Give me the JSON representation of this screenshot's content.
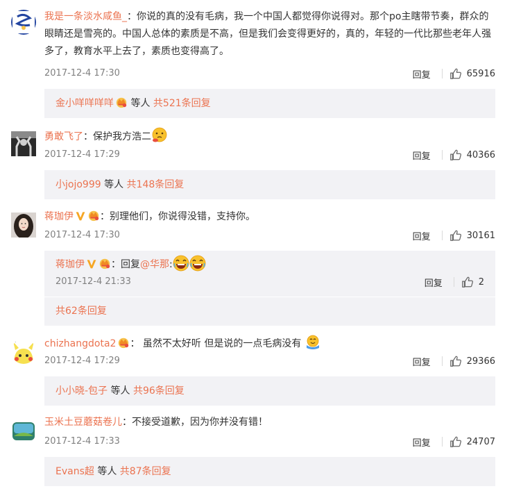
{
  "comments": [
    {
      "user": "我是一条淡水咸鱼_",
      "text": "：你说的真的没有毛病，我一个中国人都觉得你说得对。那个po主瞎带节奏，群众的眼睛还是雪亮的。中国人总体的素质是不高，但是我们会变得更好的，真的，年轻的一代比那些老年人强多了，教育水平上去了，素质也变得高了。",
      "time": "2017-12-4 17:30",
      "reply_label": "回复",
      "likes": "65916",
      "more_user": "金小咩咩咩咩",
      "more_mid": " 等人 ",
      "more_count": "共521条回复"
    },
    {
      "user": "勇敢飞了",
      "text": "：保护我方浩二",
      "time": "2017-12-4 17:29",
      "reply_label": "回复",
      "likes": "40366",
      "more_user": "小jojo999",
      "more_mid": " 等人 ",
      "more_count": "共148条回复"
    },
    {
      "user": "蒋珈伊",
      "text": "：别理他们，你说得没错，支持你。",
      "time": "2017-12-4 17:30",
      "reply_label": "回复",
      "likes": "30161",
      "sub_reply": {
        "user": "蒋珈伊",
        "text_a": "：回复",
        "mention": "@华那",
        "text_b": ":",
        "time": "2017-12-4 21:33",
        "reply_label": "回复",
        "likes": "2"
      },
      "more_count": "共62条回复"
    },
    {
      "user": "chizhangdota2",
      "text": "： 虽然不太好听 但是说的一点毛病没有",
      "time": "2017-12-4 17:29",
      "reply_label": "回复",
      "likes": "29366",
      "more_user": "小小晓-包子",
      "more_mid": " 等人 ",
      "more_count": "共96条回复"
    },
    {
      "user": "玉米土豆蘑菇卷儿",
      "text": "：不接受道歉，因为你并没有错！",
      "time": "2017-12-4 17:33",
      "reply_label": "回复",
      "likes": "24707",
      "more_user": "Evans超",
      "more_mid": " 等人 ",
      "more_count": "共87条回复"
    }
  ],
  "icons": {
    "like": "thumbs-up-icon",
    "vip": "verified-v-icon",
    "member": "member-crown-icon"
  },
  "colors": {
    "link": "#eb7350",
    "text": "#333333",
    "meta": "#808080",
    "panel": "#f2f2f5"
  }
}
